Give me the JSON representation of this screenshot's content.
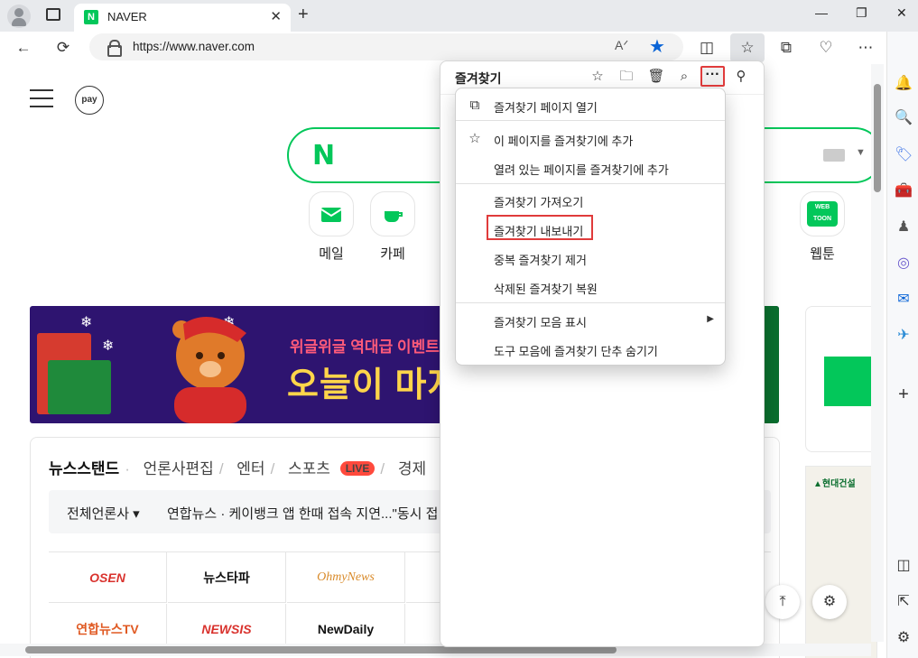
{
  "browser": {
    "tab_title": "NAVER",
    "tab_favicon": "N",
    "url": "https://www.naver.com",
    "readaloud_label": "A̅"
  },
  "page": {
    "pay_label": "pay",
    "search_logo": "N",
    "services": [
      {
        "label": "메일"
      },
      {
        "label": "카페"
      },
      {
        "label": "웹툰"
      }
    ],
    "webtoon_badge": "WEB TOON",
    "banner": {
      "line1": "위글위글 역대급 이벤트",
      "line2": "오늘이 마지"
    },
    "news": {
      "tabs": [
        {
          "label": "뉴스스탠드",
          "active": true
        },
        {
          "label": "언론사편집",
          "active": false
        },
        {
          "label": "엔터",
          "active": false
        },
        {
          "label": "스포츠",
          "active": false
        },
        {
          "label": "경제",
          "active": false
        }
      ],
      "live_badge": "LIVE",
      "ticker_source": "전체언론사 ▾",
      "ticker_text": "연합뉴스 · 케이뱅크 앱 한때 접속 지연...\"동시 접",
      "logos": [
        "OSEN",
        "뉴스타파",
        "OhmyNews",
        "연합뉴스TV",
        "NEWSIS",
        "NewDaily"
      ]
    },
    "right_ad_label": "▲현대건설"
  },
  "favorites_panel": {
    "title": "즐겨찾기"
  },
  "menu": {
    "items": [
      {
        "label": "즐겨찾기 페이지 열기",
        "icon": "open-external-icon"
      },
      {
        "label": "이 페이지를 즐겨찾기에 추가",
        "icon": "star-add-icon"
      },
      {
        "label": "열려 있는 페이지를 즐겨찾기에 추가",
        "icon": ""
      },
      {
        "label": "즐겨찾기 가져오기",
        "icon": ""
      },
      {
        "label": "즐겨찾기 내보내기",
        "icon": "",
        "highlighted": true
      },
      {
        "label": "중복 즐겨찾기 제거",
        "icon": ""
      },
      {
        "label": "삭제된 즐겨찾기 복원",
        "icon": ""
      },
      {
        "label": "즐겨찾기 모음 표시",
        "icon": "",
        "submenu": true
      },
      {
        "label": "도구 모음에 즐겨찾기 단추 숨기기",
        "icon": ""
      }
    ]
  },
  "colors": {
    "naver_green": "#03c75a",
    "edge_blue": "#0a64d6",
    "highlight_red": "#e03b3b"
  }
}
